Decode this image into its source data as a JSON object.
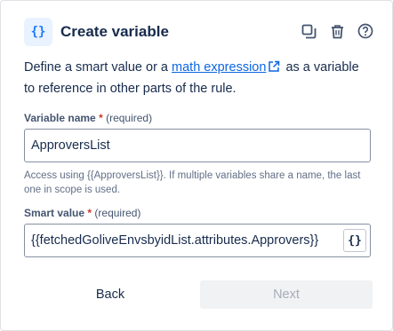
{
  "header": {
    "badge_glyph": "{}",
    "title": "Create variable",
    "icons": [
      "copy-icon",
      "trash-icon",
      "help-icon"
    ]
  },
  "description": {
    "before_link": "Define a smart value or a ",
    "link_text": "math expression",
    "after_link": " as a variable to reference in other parts of the rule."
  },
  "variable_name": {
    "label": "Variable name",
    "required_mark": "*",
    "required_text": "(required)",
    "value": "ApproversList",
    "help": "Access using {{ApproversList}}. If multiple variables share a name, the last one in scope is used."
  },
  "smart_value": {
    "label": "Smart value",
    "required_mark": "*",
    "required_text": "(required)",
    "value": "{{fetchedGoliveEnvsbyidList.attributes.Approvers}}",
    "insert_button_glyph": "{}"
  },
  "footer": {
    "back_label": "Back",
    "next_label": "Next"
  },
  "colors": {
    "accent": "#0c66e4",
    "required": "#c9372c",
    "disabled_bg": "#f1f2f4"
  }
}
